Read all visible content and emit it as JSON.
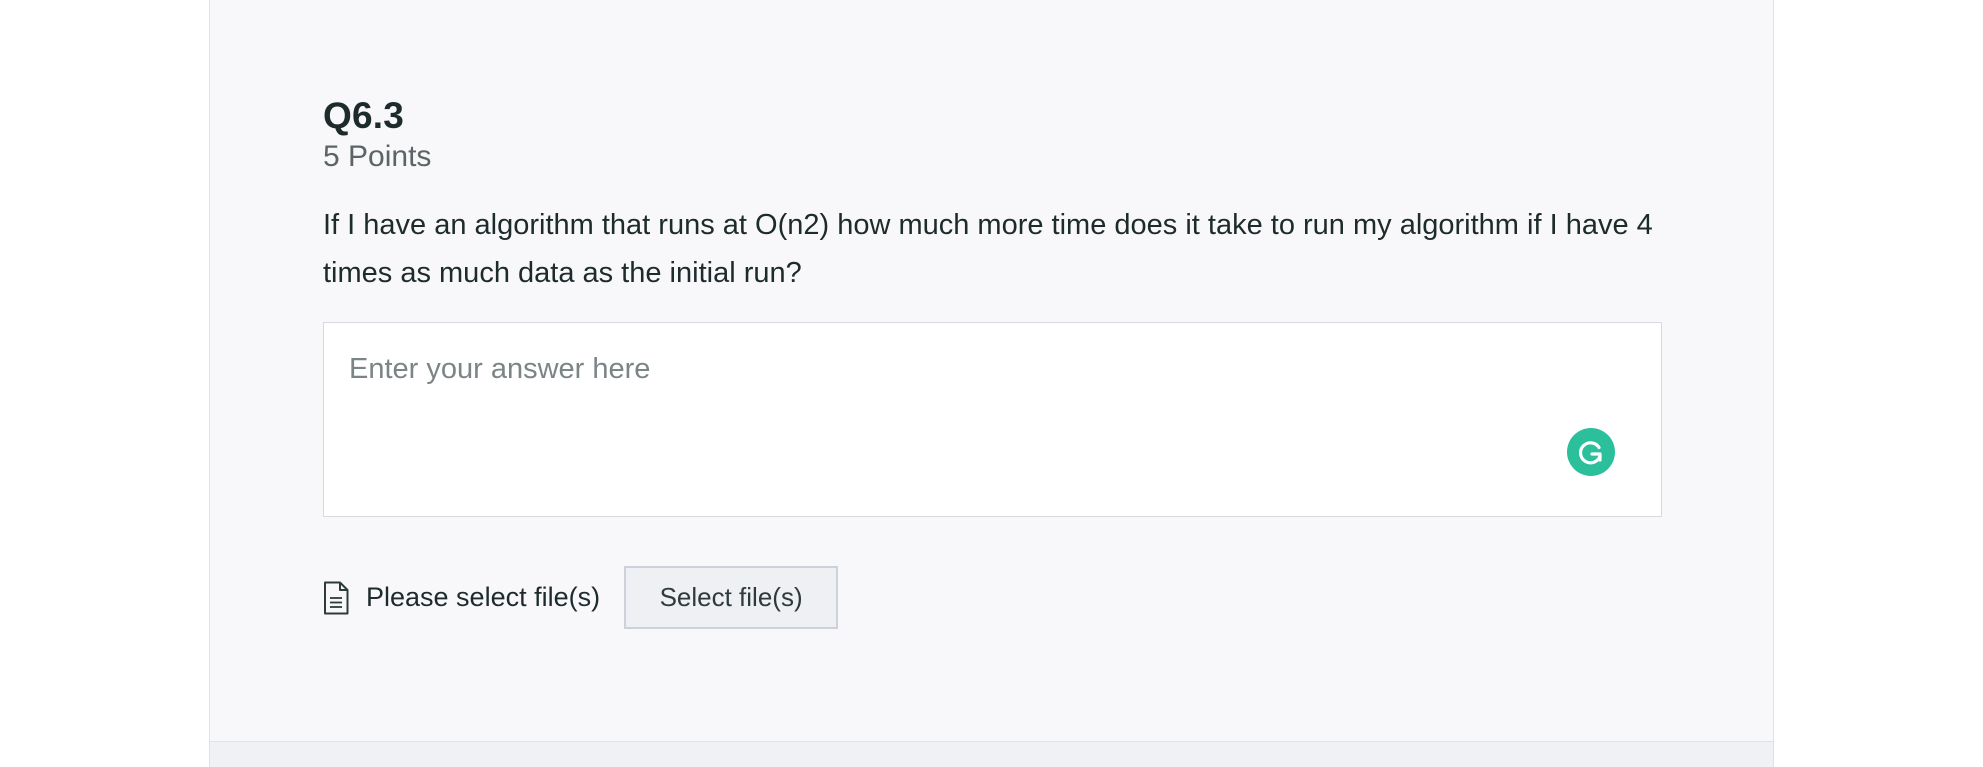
{
  "question": {
    "title": "Q6.3",
    "points": "5 Points",
    "prompt": "If I have an algorithm that runs at O(n2) how much more time does it take to run my algorithm if I have 4 times as much data as the initial run?"
  },
  "answer": {
    "placeholder": "Enter your answer here",
    "value": ""
  },
  "files": {
    "label": "Please select file(s)",
    "button_label": "Select file(s)"
  },
  "icons": {
    "file": "document-icon",
    "grammarly": "grammarly-icon"
  },
  "colors": {
    "accent_grammarly": "#2bbf9b",
    "text_primary": "#1e2b2b",
    "text_secondary": "#5b6566",
    "panel_bg": "#f8f8fa"
  }
}
